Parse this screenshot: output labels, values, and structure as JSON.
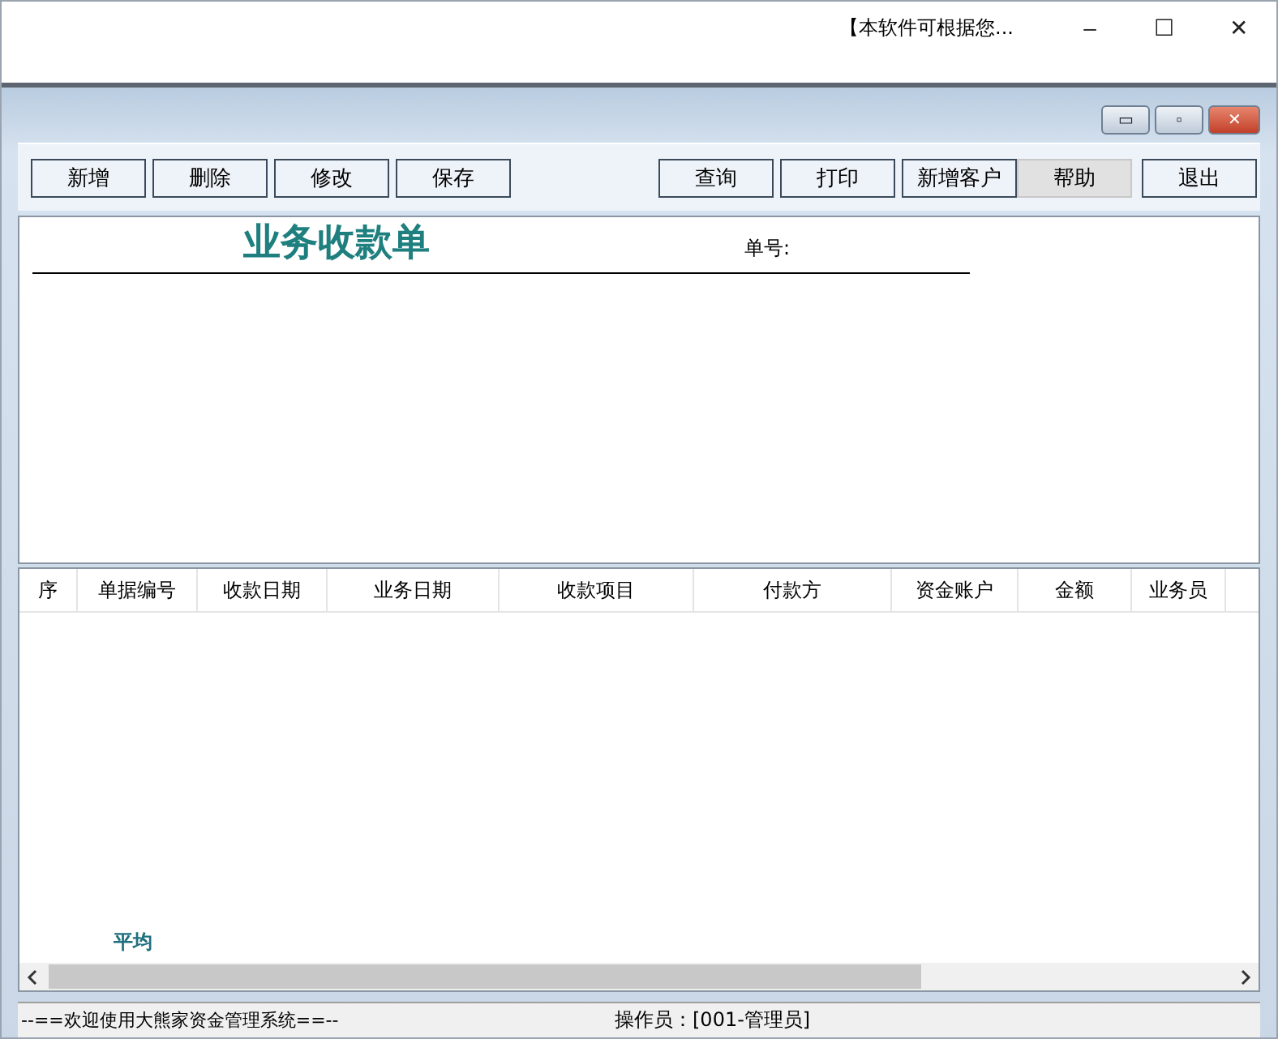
{
  "window": {
    "title": "【本软件可根据您...",
    "controls": [
      "–",
      "☐",
      "✕"
    ]
  },
  "inner_controls": [
    "▭",
    "▫",
    "✕"
  ],
  "toolbar": {
    "left": [
      {
        "label": "新增",
        "highlighted": false
      },
      {
        "label": "删除",
        "highlighted": false
      },
      {
        "label": "修改",
        "highlighted": false
      },
      {
        "label": "保存",
        "highlighted": false
      }
    ],
    "right": [
      {
        "label": "查询",
        "highlighted": false
      },
      {
        "label": "打印",
        "highlighted": false
      },
      {
        "label": "新增客户",
        "highlighted": false
      },
      {
        "label": "帮助",
        "highlighted": true
      },
      {
        "label": "退出",
        "highlighted": false
      }
    ]
  },
  "form": {
    "title": "业务收款单",
    "number_label": "单号:"
  },
  "table": {
    "columns": [
      "序",
      "单据编号",
      "收款日期",
      "业务日期",
      "收款项目",
      "付款方",
      "资金账户",
      "金额",
      "业务员"
    ],
    "footer": "平均"
  },
  "status_bar": {
    "left": "--==欢迎使用大熊家资金管理系统==--",
    "operator": "操作员：[001-管理员]"
  }
}
